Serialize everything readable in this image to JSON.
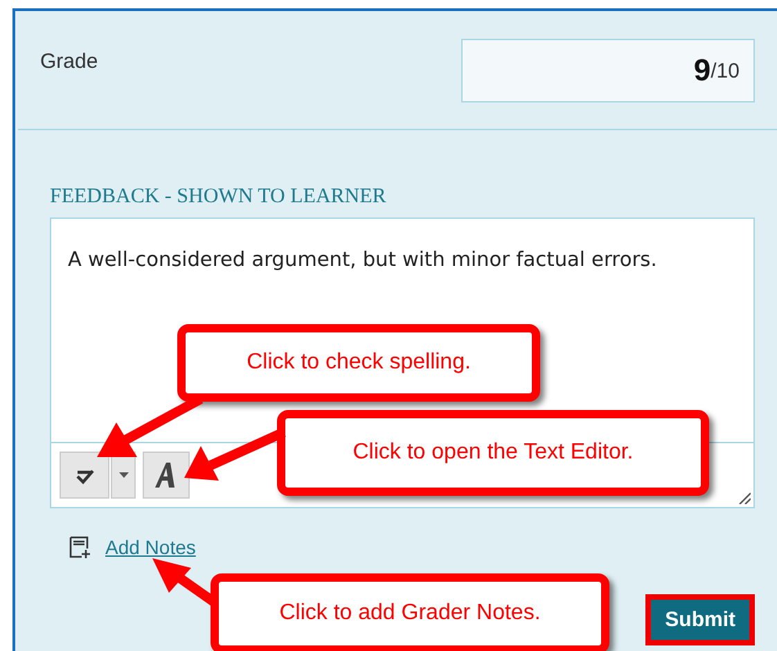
{
  "grade": {
    "label": "Grade",
    "score": "9",
    "max": "/10"
  },
  "feedback": {
    "label": "FEEDBACK - SHOWN TO LEARNER",
    "text": "A well-considered argument, but with minor factual errors."
  },
  "add_notes": {
    "label": "Add Notes"
  },
  "submit": {
    "label": "Submit"
  },
  "callouts": [
    {
      "text": "Click to check spelling."
    },
    {
      "text": "Click to open the Text Editor."
    },
    {
      "text": "Click to add Grader Notes."
    }
  ]
}
